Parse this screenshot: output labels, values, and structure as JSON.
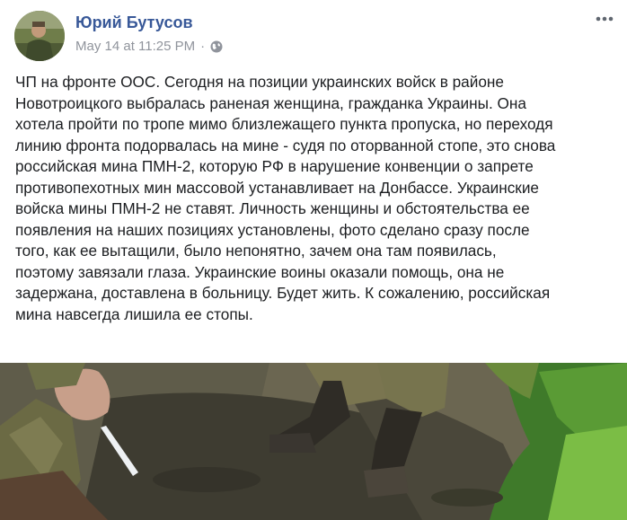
{
  "post": {
    "author": "Юрий Бутусов",
    "timestamp": "May 14 at 11:25 PM",
    "separator": "·",
    "privacy_icon": "globe-icon",
    "more_icon": "more-options-icon",
    "text_lines": [
      "ЧП на фронте ООС. Сегодня на позиции украинских войск в районе",
      "Новотроицкого выбралась раненая женщина, гражданка Украины. Она",
      "хотела пройти по тропе мимо близлежащего пункта пропуска, но переходя",
      "линию фронта подорвалась на мине - судя по оторванной стопе, это снова",
      "российская мина ПМН-2, которую РФ в нарушение конвенции о запрете",
      "противопехотных мин массовой устанавливает на Донбассе. Украинские",
      "войска мины ПМН-2 не ставят. Личность женщины и обстоятельства ее",
      "появления на наших позициях установлены, фото сделано сразу после",
      "того, как ее вытащили, было непонятно, зачем она там появилась,",
      "поэтому завязали глаза. Украинские воины оказали помощь, она не",
      "задержана, доставлена в больницу. Будет жить. К сожалению, российская",
      "мина навсегда лишила ее стопы."
    ]
  },
  "colors": {
    "author": "#385898",
    "meta": "#90949c",
    "text": "#1c1e21"
  }
}
